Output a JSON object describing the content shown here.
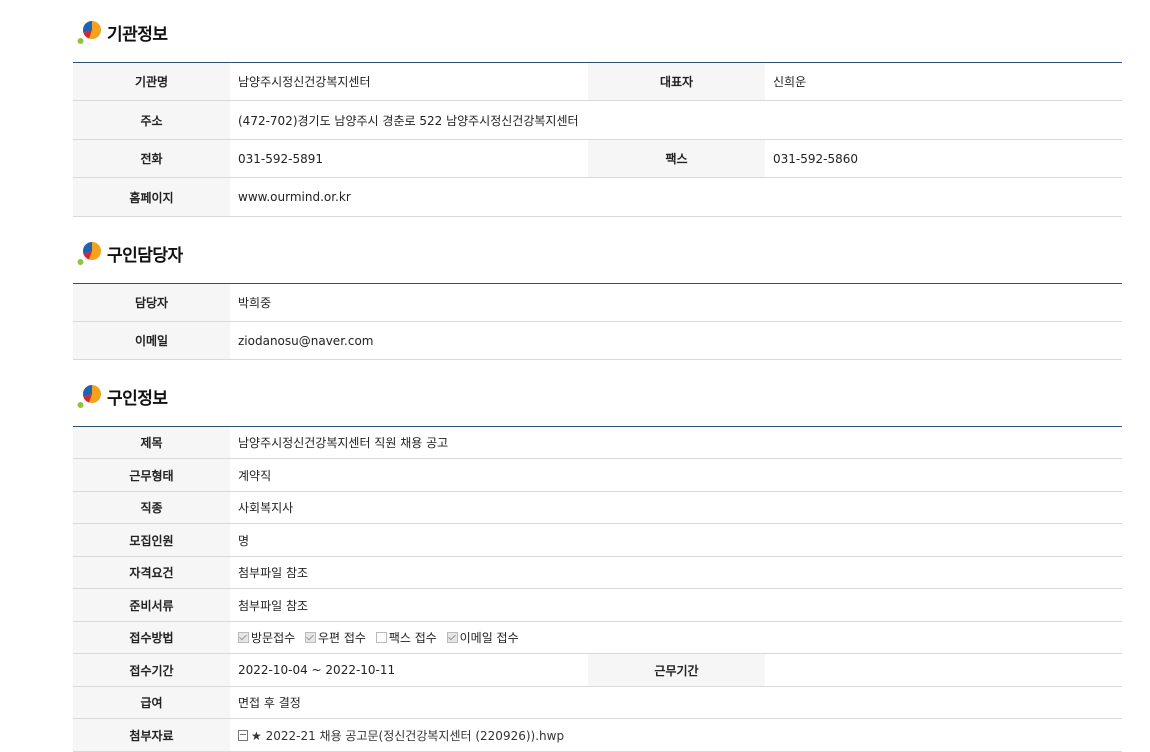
{
  "sections": {
    "org": {
      "title": "기관정보",
      "rows": {
        "name_label": "기관명",
        "name": "남양주시정신건강복지센터",
        "ceo_label": "대표자",
        "ceo": "신희운",
        "address_label": "주소",
        "address": "(472-702)경기도 남양주시 경춘로 522 남양주시정신건강복지센터",
        "phone_label": "전화",
        "phone": "031-592-5891",
        "fax_label": "팩스",
        "fax": "031-592-5860",
        "homepage_label": "홈페이지",
        "homepage": "www.ourmind.or.kr"
      }
    },
    "contact": {
      "title": "구인담당자",
      "rows": {
        "person_label": "담당자",
        "person": "박희중",
        "email_label": "이메일",
        "email": "ziodanosu@naver.com"
      }
    },
    "job": {
      "title": "구인정보",
      "rows": {
        "subject_label": "제목",
        "subject": "남양주시정신건강복지센터 직원 채용 공고",
        "worktype_label": "근무형태",
        "worktype": "계약직",
        "jobkind_label": "직종",
        "jobkind": "사회복지사",
        "headcount_label": "모집인원",
        "headcount": "명",
        "qual_label": "자격요건",
        "qual": "첨부파일 참조",
        "docs_label": "준비서류",
        "docs": "첨부파일 참조",
        "method_label": "접수방법",
        "methods": [
          {
            "label": "방문접수",
            "checked": true
          },
          {
            "label": "우편 접수",
            "checked": true
          },
          {
            "label": "팩스 접수",
            "checked": false
          },
          {
            "label": "이메일 접수",
            "checked": true
          }
        ],
        "period_label": "접수기간",
        "period": "2022-10-04 ~ 2022-10-11",
        "workperiod_label": "근무기간",
        "workperiod": "",
        "salary_label": "급여",
        "salary": "면접 후 결정",
        "attach_label": "첨부자료",
        "attach": "★ 2022-21 채용 공고문(정신건강복지센터 (220926)).hwp"
      }
    }
  },
  "colors": {
    "table_top_border": "#2f4f6f",
    "header_bg": "#f6f6f6"
  }
}
